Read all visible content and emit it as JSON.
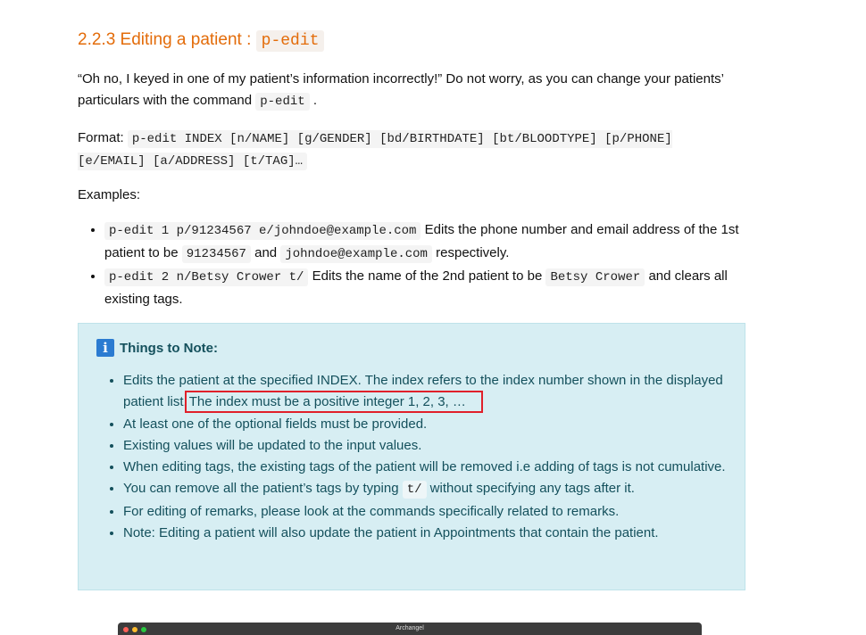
{
  "section": {
    "title_prefix": "2.2.3 Editing a patient : ",
    "title_code": "p-edit",
    "intro_text": "“Oh no, I keyed in one of my patient’s information incorrectly!” Do not worry, as you can change your patients’ particulars with the command ",
    "intro_code": "p-edit",
    "intro_end": ".",
    "format_label": "Format: ",
    "format_code": "p-edit INDEX [n/NAME] [g/GENDER] [bd/BIRTHDATE] [bt/BLOODTYPE] [p/PHONE] [e/EMAIL] [a/ADDRESS] [t/TAG]…",
    "examples_label": "Examples:",
    "example1": {
      "code": "p-edit 1 p/91234567 e/johndoe@example.com",
      "text1": " Edits the phone number and email address of the 1st patient to be ",
      "code2": "91234567",
      "text2": " and ",
      "code3": "johndoe@example.com",
      "text3": " respectively."
    },
    "example2": {
      "code": "p-edit 2 n/Betsy Crower t/",
      "text1": " Edits the name of the 2nd patient to be ",
      "code2": "Betsy Crower",
      "text2": " and clears all existing tags."
    }
  },
  "note": {
    "icon": "info-icon",
    "title": "Things to Note:",
    "item1_a": "Edits the patient at the specified INDEX. The index refers to the index number shown in the displayed patient list.",
    "item1_b": "The index must be a positive integer 1, 2, 3, …",
    "item2": "At least one of the optional fields must be provided.",
    "item3": "Existing values will be updated to the input values.",
    "item4": "When editing tags, the existing tags of the patient will be removed i.e adding of tags is not cumulative.",
    "item5_a": "You can remove all the patient’s tags by typing ",
    "item5_code": "t/",
    "item5_b": " without specifying any tags after it.",
    "item6": "For editing of remarks, please look at the commands specifically related to remarks.",
    "item7": "Note: Editing a patient will also update the patient in Appointments that contain the patient."
  },
  "app_window": {
    "title": "Archangel"
  }
}
